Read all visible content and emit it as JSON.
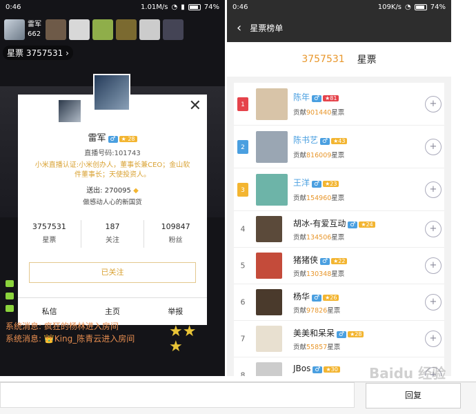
{
  "left": {
    "status": {
      "time": "0:46",
      "speed": "1.01M/s",
      "battery": "74%"
    },
    "host": {
      "name": "雷军",
      "count": "662"
    },
    "stars_label": "星票 3757531",
    "card": {
      "name": "雷军",
      "level": "28",
      "live_id": "直播号码:101743",
      "auth": "小米直播认证:小米创办人，董事长兼CEO；金山软件董事长；天使投资人。",
      "sent": "送出: 270095",
      "signature": "做感动人心的新国货",
      "stats": [
        {
          "value": "3757531",
          "label": "星票"
        },
        {
          "value": "187",
          "label": "关注"
        },
        {
          "value": "109847",
          "label": "粉丝"
        }
      ],
      "followed_label": "已关注",
      "actions": [
        "私信",
        "主页",
        "举报"
      ]
    },
    "messages": [
      "系统消息: 疯狂的杨林进入房间",
      "系统消息: 👑King_陈青云进入房间"
    ]
  },
  "right": {
    "status": {
      "time": "0:46",
      "speed": "109K/s",
      "battery": "74%"
    },
    "title": "星票榜单",
    "total": "3757531",
    "total_label": "星票",
    "contrib_prefix": "贡献",
    "contrib_suffix": "星票",
    "rows": [
      {
        "rank": "1",
        "name": "陈年",
        "level": "81",
        "contrib": "901440"
      },
      {
        "rank": "2",
        "name": "陈书艺",
        "level": "43",
        "contrib": "816009"
      },
      {
        "rank": "3",
        "name": "王洋",
        "level": "23",
        "contrib": "154960"
      },
      {
        "rank": "4",
        "name": "胡冰-有爱互动",
        "level": "24",
        "contrib": "134506"
      },
      {
        "rank": "5",
        "name": "猪猪侠",
        "level": "22",
        "contrib": "130348"
      },
      {
        "rank": "6",
        "name": "杨华",
        "level": "26",
        "contrib": "97826"
      },
      {
        "rank": "7",
        "name": "美美和呆呆",
        "level": "28",
        "contrib": "55857"
      },
      {
        "rank": "8",
        "name": "JBos",
        "level": "30",
        "contrib": ""
      }
    ]
  },
  "footer": {
    "reply_label": "回复",
    "watermark": "Baidu 经验"
  },
  "colors": {
    "accent": "#e8962a",
    "blue": "#4a9fe0"
  }
}
